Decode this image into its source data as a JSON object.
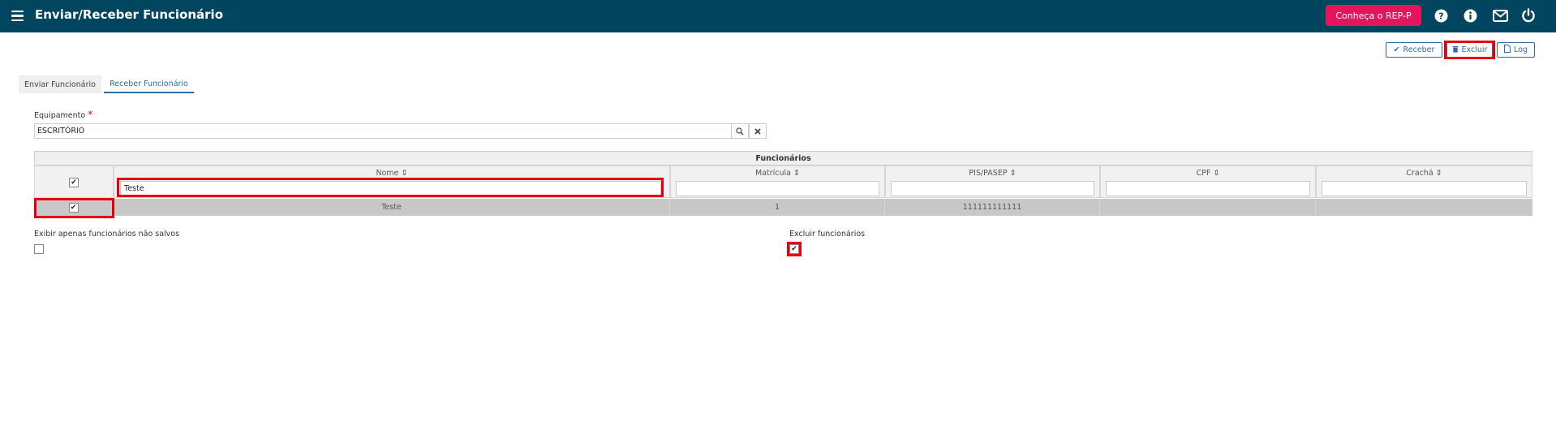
{
  "header": {
    "title": "Enviar/Receber Funcionário",
    "promo_button": "Conheça o REP-P",
    "icons": [
      "question-icon",
      "info-icon",
      "mail-icon",
      "power-icon"
    ]
  },
  "actions": {
    "receive": "Receber",
    "delete": "Excluir",
    "log": "Log"
  },
  "tabs": [
    {
      "label": "Enviar Funcionário",
      "active": false
    },
    {
      "label": "Receber Funcionário",
      "active": true
    }
  ],
  "equipment": {
    "label": "Equipamento",
    "required_mark": "*",
    "value": "ESCRITÓRIO"
  },
  "grid": {
    "title": "Funcionários",
    "columns": [
      {
        "label": "Nome",
        "sort": "⇕",
        "filter": "Teste"
      },
      {
        "label": "Matrícula",
        "sort": "⇕",
        "filter": ""
      },
      {
        "label": "PIS/PASEP",
        "sort": "⇕",
        "filter": ""
      },
      {
        "label": "CPF",
        "sort": "⇕",
        "filter": ""
      },
      {
        "label": "Crachá",
        "sort": "⇕",
        "filter": ""
      }
    ],
    "select_all_checked": true,
    "rows": [
      {
        "checked": true,
        "nome": "Teste",
        "matricula": "1",
        "pis": "111111111111",
        "cpf": "",
        "cracha": ""
      }
    ]
  },
  "options": {
    "unsaved_only_label": "Exibir apenas funcionários não salvos",
    "unsaved_only_checked": false,
    "delete_employees_label": "Excluir funcionários",
    "delete_employees_checked": true
  },
  "colors": {
    "topbar": "#01465e",
    "promo": "#e6145d",
    "accent": "#2f6ea5",
    "highlight": "#e3000f"
  }
}
